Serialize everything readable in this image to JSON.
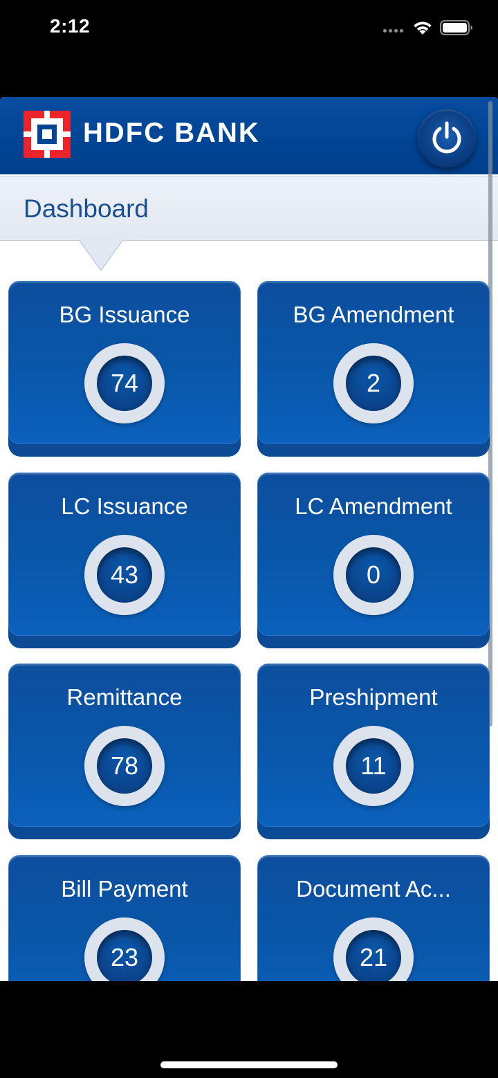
{
  "status_bar": {
    "time": "2:12",
    "icons": [
      "cellular-signal-icon",
      "wifi-icon",
      "battery-icon"
    ]
  },
  "header": {
    "brand_name": "HDFC BANK",
    "logo_icon": "hdfc-logo-icon",
    "power_icon": "power-icon"
  },
  "page": {
    "title": "Dashboard"
  },
  "tiles": [
    {
      "label": "BG Issuance",
      "count": "74"
    },
    {
      "label": "BG Amendment",
      "count": "2"
    },
    {
      "label": "LC Issuance",
      "count": "43"
    },
    {
      "label": "LC Amendment",
      "count": "0"
    },
    {
      "label": "Remittance",
      "count": "78"
    },
    {
      "label": "Preshipment",
      "count": "11"
    },
    {
      "label": "Bill Payment",
      "count": "23"
    },
    {
      "label": "Document Ac...",
      "count": "21"
    }
  ],
  "colors": {
    "brand_blue": "#004494",
    "brand_red": "#ed232a",
    "tile_blue": "#0957aa",
    "header_bar": "#e2e8f1"
  }
}
